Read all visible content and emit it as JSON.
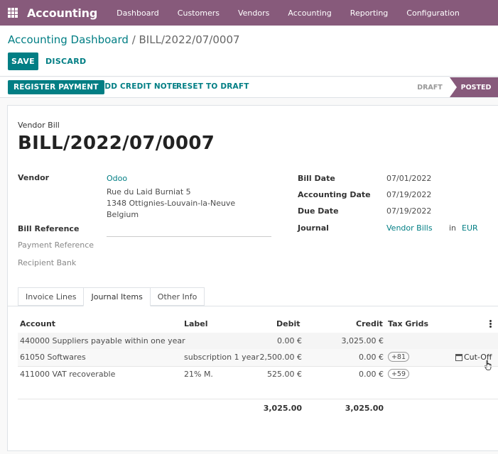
{
  "navbar": {
    "brand": "Accounting",
    "menu": [
      "Dashboard",
      "Customers",
      "Vendors",
      "Accounting",
      "Reporting",
      "Configuration"
    ]
  },
  "breadcrumb": {
    "parent": "Accounting Dashboard",
    "separator": " / ",
    "current": "BILL/2022/07/0007"
  },
  "actions": {
    "save": "SAVE",
    "discard": "DISCARD"
  },
  "statusbar": {
    "register_payment": "REGISTER PAYMENT",
    "add_credit_note": "ADD CREDIT NOTE",
    "reset_to_draft": "RESET TO DRAFT",
    "stages": [
      "DRAFT",
      "POSTED"
    ],
    "active_stage": "POSTED"
  },
  "document": {
    "type": "Vendor Bill",
    "name": "BILL/2022/07/0007"
  },
  "fields": {
    "vendor_label": "Vendor",
    "vendor_name": "Odoo",
    "vendor_address": [
      "Rue du Laid Burniat 5",
      "1348 Ottignies-Louvain-la-Neuve",
      "Belgium"
    ],
    "bill_reference_label": "Bill Reference",
    "payment_reference_label": "Payment Reference",
    "recipient_bank_label": "Recipient Bank",
    "bill_date_label": "Bill Date",
    "bill_date": "07/01/2022",
    "accounting_date_label": "Accounting Date",
    "accounting_date": "07/19/2022",
    "due_date_label": "Due Date",
    "due_date": "07/19/2022",
    "journal_label": "Journal",
    "journal": "Vendor Bills",
    "in_label": "in",
    "currency": "EUR"
  },
  "tabs": [
    "Invoice Lines",
    "Journal Items",
    "Other Info"
  ],
  "active_tab": "Journal Items",
  "table": {
    "headers": [
      "Account",
      "Label",
      "Debit",
      "Credit",
      "Tax Grids"
    ],
    "rows": [
      {
        "account": "440000 Suppliers payable within one year",
        "label": "",
        "debit": "0.00 €",
        "credit": "3,025.00 €",
        "tax_grid": ""
      },
      {
        "account": "61050 Softwares",
        "label": "subscription 1 year",
        "debit": "2,500.00 €",
        "credit": "0.00 €",
        "tax_grid": "+81",
        "action": "Cut-Off"
      },
      {
        "account": "411000 VAT recoverable",
        "label": "21% M.",
        "debit": "525.00 €",
        "credit": "0.00 €",
        "tax_grid": "+59"
      }
    ],
    "total_debit": "3,025.00",
    "total_credit": "3,025.00"
  },
  "colors": {
    "brand": "#875a7b",
    "accent": "#017e84"
  }
}
